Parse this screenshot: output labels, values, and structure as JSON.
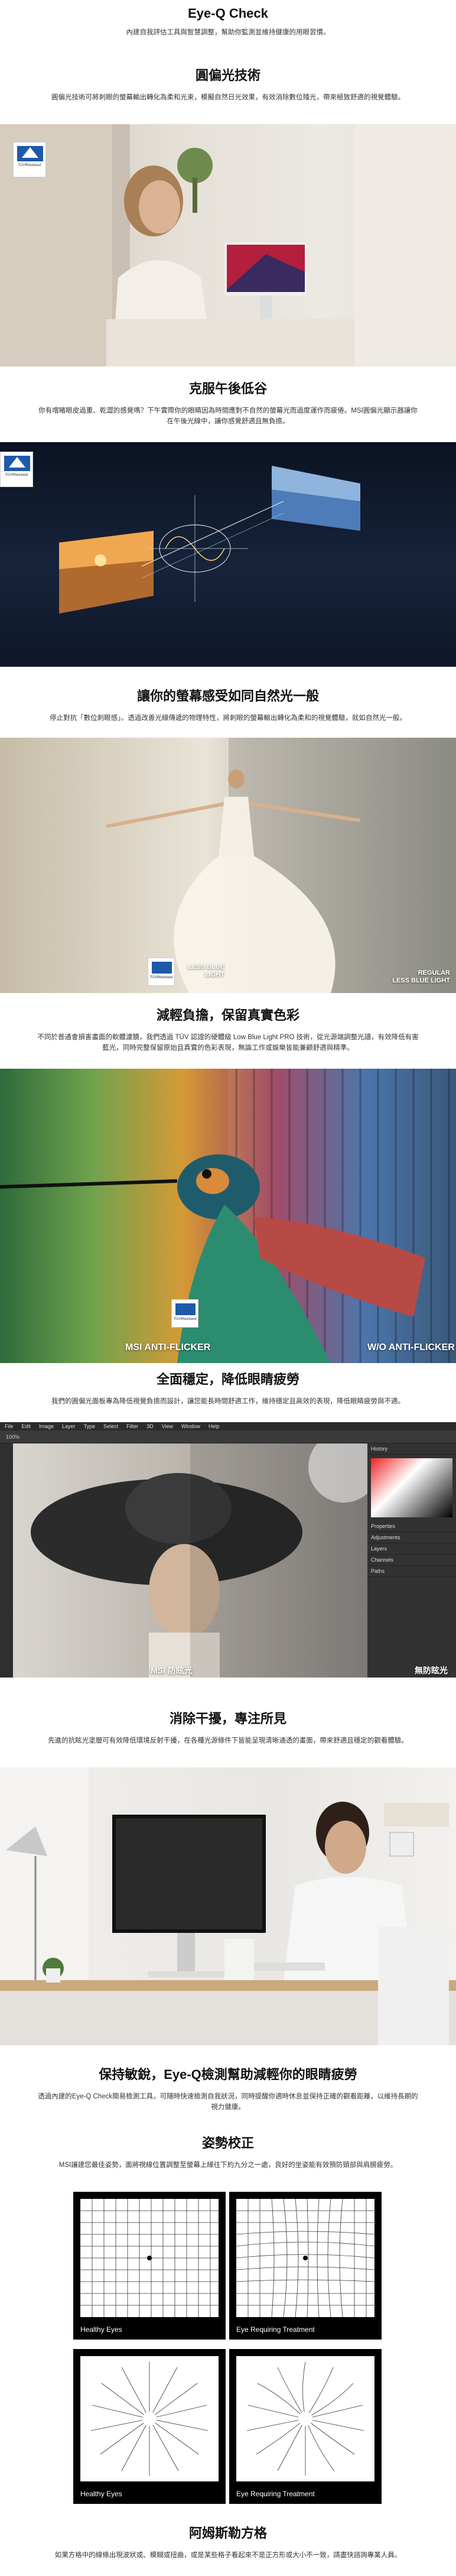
{
  "header": {
    "title": "Eye-Q Check",
    "subtitle": "內建自我評估工具與智慧調整，幫助你監測並維持健康的用眼習慣。"
  },
  "sections": [
    {
      "title": "圓偏光技術",
      "desc": "圓偏光技術可將刺眼的螢幕輸出轉化為柔和光束，模擬自然日光效果，有效消除數位殘光，帶來極致舒適的視覺體驗。",
      "badge": "TÜVRheinland"
    },
    {
      "title": "克服午後低谷",
      "desc": "你有嚐睹眼皮過重、乾澀的感覺嗎？下午實際你的眼睛因為時間應對不自然的螢幕光而過度運作而疲倦。MSI圓偏光顯示器讓你在午後光線中，讓你感覺舒適且無負擔。",
      "badge": "TÜVRheinland"
    },
    {
      "title": "讓你的螢幕感受如同自然光一般",
      "desc": "停止對抗「數位刺眼感」。透過改善光線傳遞的物理特性，將刺眼的螢幕輸出轉化為柔和的視覺體驗，就如自然光一般。",
      "label_left": "LESS BLUE LIGHT",
      "label_right_1": "REGULAR",
      "label_right_2": "LESS BLUE LIGHT",
      "badge": "TÜVRheinland"
    },
    {
      "title": "減輕負擔，保留真實色彩",
      "desc": "不同於普通會損害畫面的軟體濾鏡，我們透過 TÜV 認證的硬體級 Low Blue Light PRO 技術，從光源端調整光譜，有效降低有害藍光，同時完整保留原始且真實的色彩表現，無論工作或娛樂皆能兼顧舒適與精準。",
      "label_left": "MSI ANTI-FLICKER",
      "label_right": "W/O ANTI-FLICKER",
      "badge": "TÜVRheinland"
    },
    {
      "title": "全面穩定，降低眼睛疲勞",
      "desc": "我們的圓偏光面板專為降低視覺負擔而設計，讓您能長時間舒適工作，維持穩定且高效的表現，降低眼睛疲勞與不適。",
      "label_left": "MSI 防眩光",
      "label_right": "無防眩光",
      "menu": [
        "File",
        "Edit",
        "Image",
        "Layer",
        "Type",
        "Select",
        "Filter",
        "3D",
        "View",
        "Window",
        "Help"
      ],
      "panel_tabs": [
        "History",
        "Properties",
        "Adjustments",
        "Layers",
        "Channels",
        "Paths"
      ],
      "zoom": "100%"
    },
    {
      "title": "消除干擾，專注所見",
      "desc": "先進的抗眩光塗層可有效降低環境反射干擾，在各種光源條件下皆能呈現清晰通透的畫面，帶來舒適且穩定的觀看體驗。"
    },
    {
      "title": "保持敏銳，Eye-Q檢測幫助減輕你的眼睛疲勞",
      "desc": "透過內建的Eye-Q Check簡易檢測工具，可隨時快速檢測自我狀況，同時提醒你適時休息並保持正確的觀看距離，以維持長期的視力健康。"
    },
    {
      "title": "姿勢校正",
      "desc": "MSI讓建您最佳姿勢，面將視線位置調整至螢幕上緣往下約九分之一處，良好的坐姿能有效預防頸部與肩膀疲勞。",
      "cards": [
        "Healthy Eyes",
        "Eye Requiring Treatment",
        "Healthy Eyes",
        "Eye Requiring Treatment"
      ]
    },
    {
      "title": "阿姆斯勒方格",
      "desc": "如果方格中的線條出現波狀或、模糊或扭曲，或是某些格子看起來不是正方形或大小不一致，請盡快諮詢專業人員。"
    }
  ],
  "colors": {
    "tuv_blue": "#1d5aa8",
    "ps_dark": "#2b2b2b"
  }
}
